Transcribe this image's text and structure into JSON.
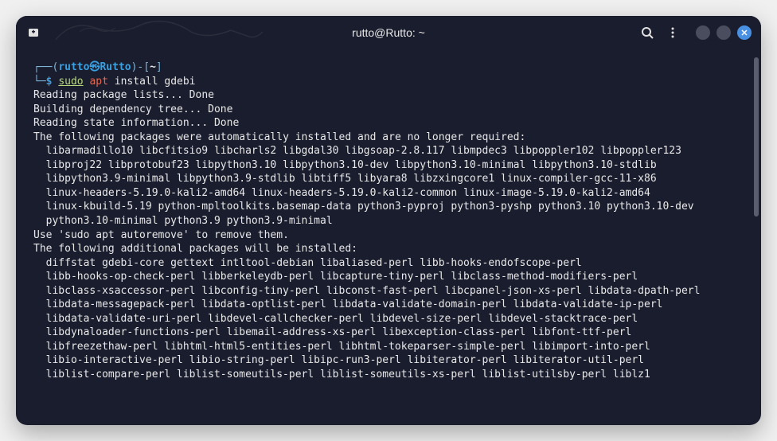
{
  "titlebar": {
    "title": "rutto@Rutto: ~"
  },
  "prompt": {
    "open_paren": "┌──(",
    "user": "rutto",
    "at": "㉿",
    "host": "Rutto",
    "close_paren": ")-[",
    "path": "~",
    "close_bracket": "]",
    "line2_prefix": "└─",
    "dollar": "$",
    "sudo": "sudo",
    "apt": "apt",
    "args": "install gdebi"
  },
  "output": {
    "l1": "Reading package lists... Done",
    "l2": "Building dependency tree... Done",
    "l3": "Reading state information... Done",
    "l4": "The following packages were automatically installed and are no longer required:",
    "l5": "libarmadillo10 libcfitsio9 libcharls2 libgdal30 libgsoap-2.8.117 libmpdec3 libpoppler102 libpoppler123",
    "l6": "libproj22 libprotobuf23 libpython3.10 libpython3.10-dev libpython3.10-minimal libpython3.10-stdlib",
    "l7": "libpython3.9-minimal libpython3.9-stdlib libtiff5 libyara8 libzxingcore1 linux-compiler-gcc-11-x86",
    "l8": "linux-headers-5.19.0-kali2-amd64 linux-headers-5.19.0-kali2-common linux-image-5.19.0-kali2-amd64",
    "l9": "linux-kbuild-5.19 python-mpltoolkits.basemap-data python3-pyproj python3-pyshp python3.10 python3.10-dev",
    "l10": "python3.10-minimal python3.9 python3.9-minimal",
    "l11": "Use 'sudo apt autoremove' to remove them.",
    "l12": "The following additional packages will be installed:",
    "l13": "diffstat gdebi-core gettext intltool-debian libaliased-perl libb-hooks-endofscope-perl",
    "l14": "libb-hooks-op-check-perl libberkeleydb-perl libcapture-tiny-perl libclass-method-modifiers-perl",
    "l15": "libclass-xsaccessor-perl libconfig-tiny-perl libconst-fast-perl libcpanel-json-xs-perl libdata-dpath-perl",
    "l16": "libdata-messagepack-perl libdata-optlist-perl libdata-validate-domain-perl libdata-validate-ip-perl",
    "l17": "libdata-validate-uri-perl libdevel-callchecker-perl libdevel-size-perl libdevel-stacktrace-perl",
    "l18": "libdynaloader-functions-perl libemail-address-xs-perl libexception-class-perl libfont-ttf-perl",
    "l19": "libfreezethaw-perl libhtml-html5-entities-perl libhtml-tokeparser-simple-perl libimport-into-perl",
    "l20": "libio-interactive-perl libio-string-perl libipc-run3-perl libiterator-perl libiterator-util-perl",
    "l21": "liblist-compare-perl liblist-someutils-perl liblist-someutils-xs-perl liblist-utilsby-perl liblz1"
  }
}
